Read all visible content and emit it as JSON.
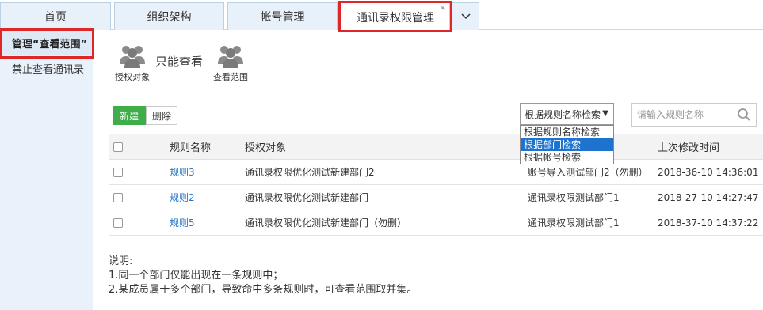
{
  "tabs": [
    {
      "label": "首页"
    },
    {
      "label": "组织架构"
    },
    {
      "label": "帐号管理"
    },
    {
      "label": "通讯录权限管理",
      "close": "×"
    }
  ],
  "tab_more_icon": "chevron-down-icon",
  "sidebar": {
    "items": [
      {
        "label": "管理“查看范围”"
      },
      {
        "label": "禁止查看通讯录"
      }
    ]
  },
  "header": {
    "grantee_label": "授权对象",
    "only_view": "只能查看",
    "scope_label": "查看范围"
  },
  "toolbar": {
    "new_label": "新建",
    "delete_label": "删除"
  },
  "search_type": {
    "selected": "根据规则名称检索",
    "options": [
      "根据规则名称检索",
      "根据部门检索",
      "根据帐号检索"
    ],
    "highlighted_index": 1
  },
  "search": {
    "placeholder": "请输入规则名称"
  },
  "table": {
    "columns": [
      "规则名称",
      "授权对象",
      "",
      "上次修改时间"
    ],
    "rows": [
      {
        "name": "规则3",
        "grantee": "通讯录权限优化测试新建部门2",
        "scope": "账号导入测试部门2（勿删）",
        "time": "2018-36-10 14:36:01"
      },
      {
        "name": "规则2",
        "grantee": "通讯录权限优化测试新建部门",
        "scope": "通讯录权限测试部门1",
        "time": "2018-27-10 14:27:47"
      },
      {
        "name": "规则5",
        "grantee": "通讯录权限优化测试新建部门（勿删）",
        "scope": "通讯录权限测试部门1",
        "time": "2018-37-10 14:37:22"
      }
    ]
  },
  "notes": {
    "title": "说明:",
    "line1": "1.同一个部门仅能出现在一条规则中；",
    "line2": "2.某成员属于多个部门，导致命中多条规则时，可查看范围取并集。"
  },
  "colors": {
    "accent_green": "#3fae49",
    "link_blue": "#2a78c9",
    "highlight_red": "#e02727",
    "sidebar_bg": "#e9f2fa"
  }
}
